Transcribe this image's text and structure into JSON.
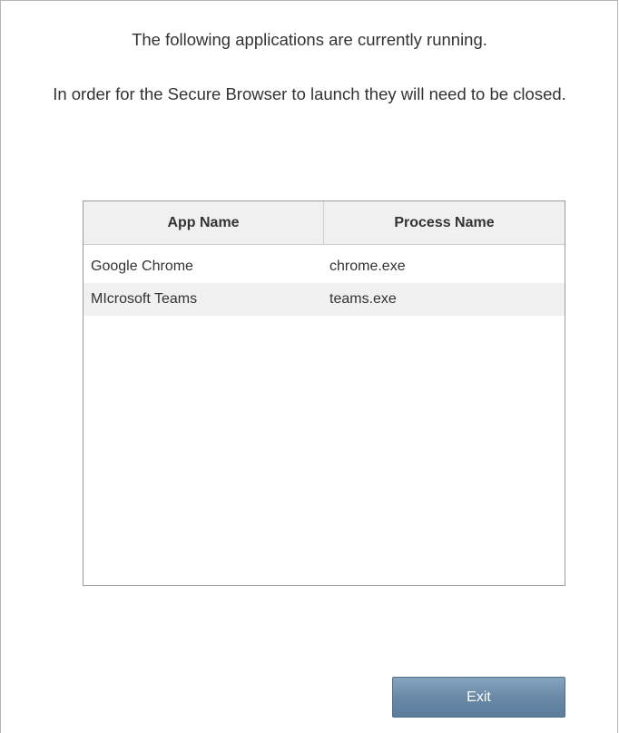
{
  "dialog": {
    "message_1": "The following applications are currently running.",
    "message_2": "In order for the Secure Browser to launch they will need to be closed."
  },
  "table": {
    "columns": [
      "App Name",
      "Process Name"
    ],
    "rows": [
      {
        "app_name": "Google Chrome",
        "process_name": "chrome.exe"
      },
      {
        "app_name": "MIcrosoft Teams",
        "process_name": "teams.exe"
      }
    ]
  },
  "buttons": {
    "exit_label": "Exit"
  },
  "colors": {
    "button_gradient_top": "#86a4be",
    "button_gradient_bottom": "#5b7c9b",
    "table_header_bg": "#f0f0f0",
    "alt_row_bg": "#f0f0f0"
  }
}
